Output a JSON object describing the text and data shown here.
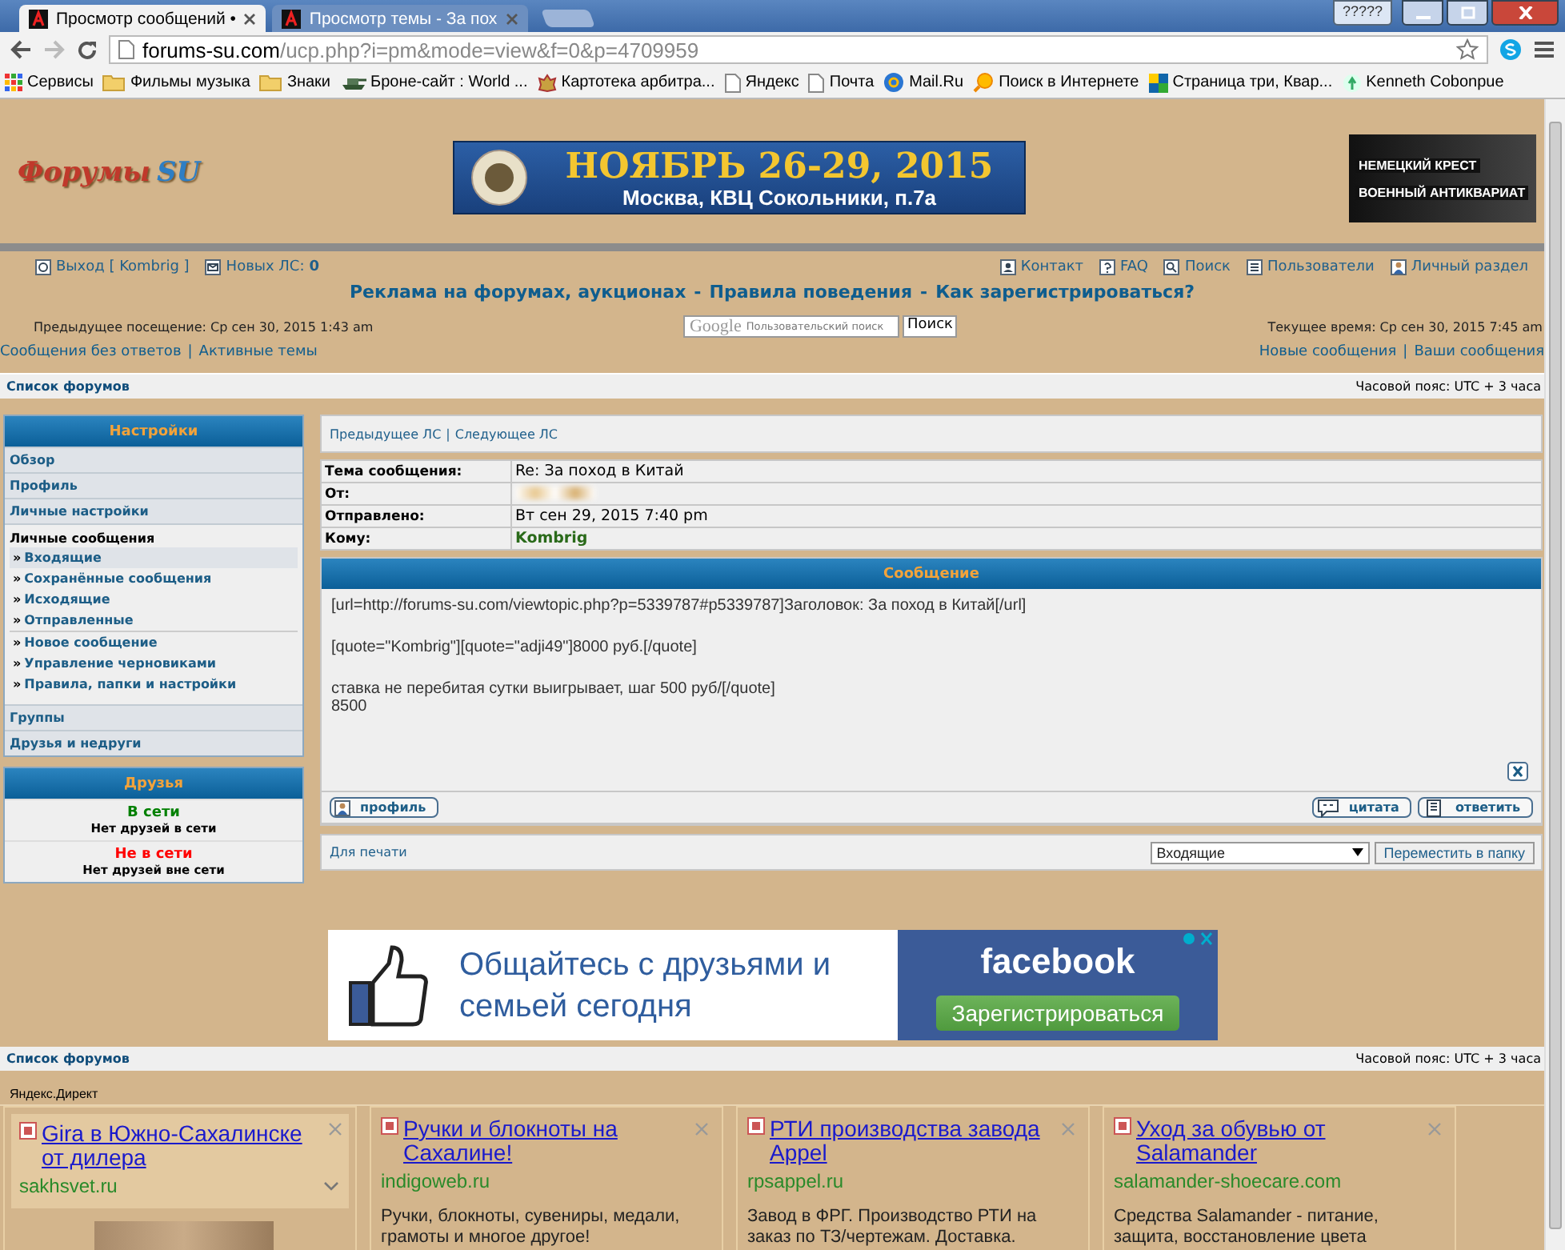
{
  "browser": {
    "tabs": [
      {
        "title": "Просмотр сообщений •",
        "selected": true
      },
      {
        "title": "Просмотр темы - За пох",
        "selected": false
      }
    ],
    "window_badge": "?????",
    "url_host": "forums-su.com",
    "url_path": "/ucp.php?i=pm&mode=view&f=0&p=4709959",
    "bookmarks": [
      {
        "label": "Сервисы",
        "kind": "apps"
      },
      {
        "label": "Фильмы музыка",
        "kind": "folder"
      },
      {
        "label": "Знаки",
        "kind": "folder"
      },
      {
        "label": "Броне-сайт : World ...",
        "kind": "tank"
      },
      {
        "label": "Картотека арбитра...",
        "kind": "emblem"
      },
      {
        "label": "Яндекс",
        "kind": "page"
      },
      {
        "label": "Почта",
        "kind": "page"
      },
      {
        "label": "Mail.Ru",
        "kind": "mail"
      },
      {
        "label": "Поиск в Интернете",
        "kind": "search"
      },
      {
        "label": "Страница три, Квар...",
        "kind": "grid"
      },
      {
        "label": "Kenneth Cobonpue",
        "kind": "leaf"
      }
    ]
  },
  "header": {
    "logo": "Форумы",
    "logo_accent": "SU",
    "banner_main": [
      "НОЯБРЬ 26-29, 2015",
      "Москва, КВЦ Сокольники, п.7а"
    ],
    "banner_side": [
      "НЕМЕЦКИЙ КРЕСТ",
      "ВОЕННЫЙ АНТИКВАРИАТ"
    ]
  },
  "nav": {
    "left": [
      {
        "label": "Выход [ Kombrig ]"
      },
      {
        "label": "Новых ЛС:",
        "count": "0"
      }
    ],
    "right": [
      {
        "label": "Контакт"
      },
      {
        "label": "FAQ"
      },
      {
        "label": "Поиск"
      },
      {
        "label": "Пользователи"
      },
      {
        "label": "Личный раздел"
      }
    ]
  },
  "headline": {
    "links": [
      "Реклама на форумах, аукционах",
      "Правила поведения",
      "Как зарегистрироваться?"
    ],
    "separator": "-"
  },
  "visit": {
    "last_visit": "Предыдущее посещение: Ср сен 30, 2015 1:43 am",
    "search_brand": "Google",
    "search_placeholder": "Пользовательский поиск",
    "search_button": "Поиск",
    "current_time": "Текущее время: Ср сен 30, 2015 7:45 am"
  },
  "quick_links": {
    "left": [
      "Сообщения без ответов",
      "Активные темы"
    ],
    "right": [
      "Новые сообщения",
      "Ваши сообщения"
    ],
    "separator": "|"
  },
  "breadcrumb": {
    "label": "Список форумов",
    "timezone": "Часовой пояс: UTC + 3 часа"
  },
  "sidebar": {
    "title": "Настройки",
    "sections": [
      {
        "label": "Обзор",
        "expanded": false
      },
      {
        "label": "Профиль",
        "expanded": false
      },
      {
        "label": "Личные настройки",
        "expanded": false
      },
      {
        "label": "Личные сообщения",
        "expanded": true,
        "children": [
          {
            "marker": "»",
            "label": "Входящие",
            "kind": "folder",
            "selected": true
          },
          {
            "marker": "»",
            "label": "Сохранённые сообщения",
            "kind": "folder",
            "selected": false
          },
          {
            "marker": "»",
            "label": "Исходящие",
            "kind": "folder",
            "selected": false
          },
          {
            "marker": "»",
            "label": "Отправленные",
            "kind": "folder",
            "selected": false
          },
          {
            "kind": "divider"
          },
          {
            "marker": "»",
            "label": "Новое сообщение",
            "kind": "action",
            "selected": false
          },
          {
            "marker": "»",
            "label": "Управление черновиками",
            "kind": "action",
            "selected": false
          },
          {
            "marker": "»",
            "label": "Правила, папки и настройки",
            "kind": "action",
            "selected": false
          }
        ]
      },
      {
        "label": "Группы",
        "expanded": false
      },
      {
        "label": "Друзья и недруги",
        "expanded": false
      }
    ]
  },
  "friends": {
    "title": "Друзья",
    "groups": [
      {
        "status": "В сети",
        "color": "#008000",
        "note": "Нет друзей в сети"
      },
      {
        "status": "Не в сети",
        "color": "#ff0000",
        "note": "Нет друзей вне сети"
      }
    ]
  },
  "pm": {
    "nav": [
      "Предыдущее ЛС",
      "Следующее ЛС"
    ],
    "separator": "|",
    "fields": [
      {
        "label": "Тема сообщения:",
        "value": "Re: За поход в Китай",
        "kind": "text"
      },
      {
        "label": "От:",
        "kind": "hidden"
      },
      {
        "label": "Отправлено:",
        "value": "Вт сен 29, 2015 7:40 pm",
        "kind": "text"
      },
      {
        "label": "Кому:",
        "value": "Kombrig",
        "kind": "user"
      }
    ],
    "title": "Сообщение",
    "body": [
      "[url=http://forums-su.com/viewtopic.php?p=5339787#p5339787]Заголовок: За поход в Китай[/url]",
      "[quote=\"Kombrig\"][quote=\"adji49\"]8000 руб.[/quote]",
      "ставка не перебитая сутки выигрывает, шаг 500 руб/[/quote]\n8500"
    ],
    "buttons_left": [
      "профиль"
    ],
    "buttons_right": [
      "цитата",
      "ответить"
    ],
    "print": "Для печати",
    "folder_select": "Входящие",
    "move_button": "Переместить в папку"
  },
  "fb_ad": {
    "text": "Общайтесь с друзьями и семьей сегодня",
    "brand": "facebook",
    "button": "Зарегистрироваться"
  },
  "breadcrumb_bottom": {
    "label": "Список форумов",
    "timezone": "Часовой пояс: UTC + 3 часа"
  },
  "direct": {
    "label": "Яндекс.Директ",
    "ads": [
      {
        "kind": "image",
        "title": "Gira в Южно-Сахалинске от дилера",
        "domain": "sakhsvet.ru"
      },
      {
        "kind": "text",
        "title": "Ручки и блокноты на Сахалине!",
        "domain": "indigoweb.ru",
        "text": "Ручки, блокноты, сувениры, медали, грамоты и многое другое!"
      },
      {
        "kind": "text",
        "title": "РТИ производства завода Appel",
        "domain": "rpsappel.ru",
        "text": "Завод в ФРГ. Производство РТИ на заказ по ТЗ/чертежам. Доставка."
      },
      {
        "kind": "text",
        "title": "Уход за обувью от Salamander",
        "domain": "salamander-shoecare.com",
        "text": "Средства Salamander - питание, защита, восстановление цвета"
      }
    ]
  }
}
